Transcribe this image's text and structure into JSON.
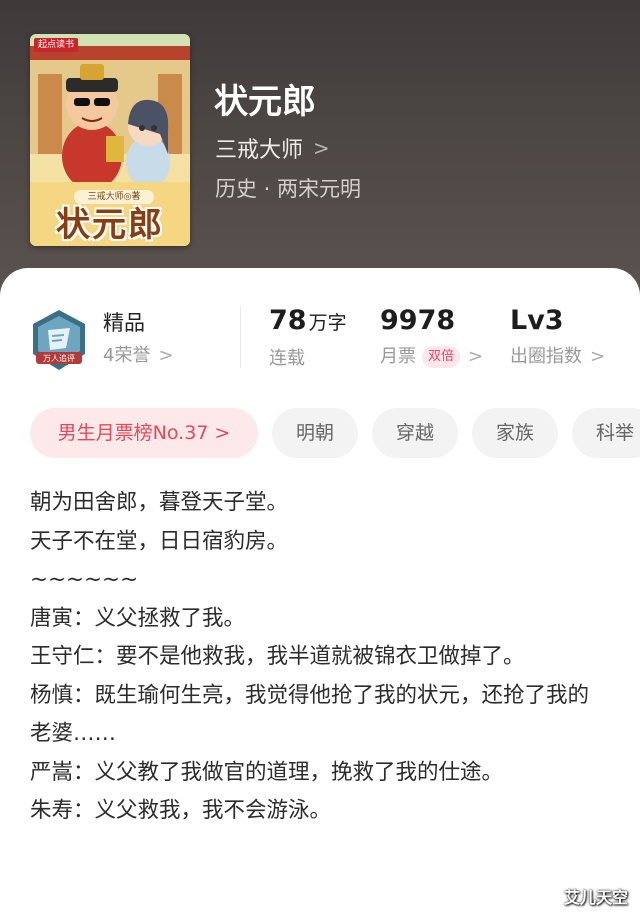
{
  "book": {
    "title": "状元郎",
    "author": "三戒大师",
    "genre": "历史 · 两宋元明",
    "cover": {
      "brand": "起点读书",
      "author_text": "三戒大师◎著",
      "title_text": "状元郎"
    }
  },
  "honor": {
    "title": "精品",
    "count": "4荣誉",
    "badge_text": "万人追评"
  },
  "stats": [
    {
      "value": "78",
      "unit": "万字",
      "label": "连载",
      "tag": "",
      "has_chevron": false
    },
    {
      "value": "9978",
      "unit": "",
      "label": "月票",
      "tag": "双倍",
      "has_chevron": true
    },
    {
      "value": "Lv3",
      "unit": "",
      "label": "出圈指数",
      "tag": "",
      "has_chevron": true
    }
  ],
  "tags": [
    {
      "label": "男生月票榜No.37 >",
      "kind": "rank"
    },
    {
      "label": "明朝",
      "kind": "plain"
    },
    {
      "label": "穿越",
      "kind": "plain"
    },
    {
      "label": "家族",
      "kind": "plain"
    },
    {
      "label": "科举",
      "kind": "plain"
    }
  ],
  "intro": [
    "朝为田舍郎，暮登天子堂。",
    "天子不在堂，日日宿豹房。",
    "~~~~~~",
    "唐寅：义父拯救了我。",
    "王守仁：要不是他救我，我半道就被锦衣卫做掉了。",
    "杨慎：既生瑜何生亮，我觉得他抢了我的状元，还抢了我的老婆……",
    "严嵩：义父教了我做官的道理，挽救了我的仕途。",
    "朱寿：义父救我，我不会游泳。"
  ],
  "watermark": "艾儿天空",
  "colors": {
    "header_bg": "#4a4441",
    "rank_tag_bg": "#fde8ea",
    "rank_tag_text": "#e24a5c",
    "double_tag_text": "#e8456b"
  }
}
